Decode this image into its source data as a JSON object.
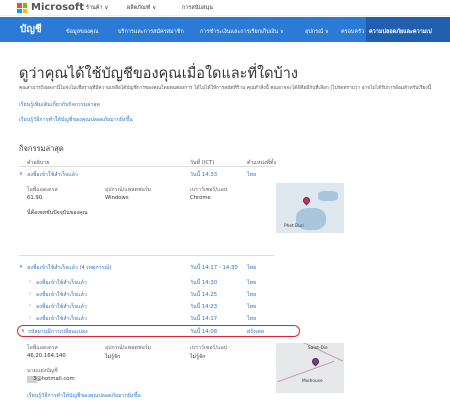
{
  "header": {
    "brand": "Microsoft",
    "nav": [
      "ร้านค้า ∨",
      "ผลิตภัณฑ์ ∨",
      "การสนับสนุน"
    ]
  },
  "account_nav": {
    "title": "บัญชี",
    "items": [
      "ข้อมูลของคุณ",
      "บริการและการสมัครสมาชิก",
      "การชำระเงินและการเรียกเก็บเงิน ∨",
      "อุปกรณ์ ∨",
      "ครอบครัว",
      "ความปลอดภัยและความเป"
    ]
  },
  "page": {
    "title": "ดูว่าคุณได้ใช้บัญชีของคุณเมื่อใดและที่ใดบ้าง",
    "description": "คุณสามารถิ่งผลงานี่ไมจ่งไม่เชื่ยรายุที่มีความเหลือได้บัญชีการของคุณโดยตนต่องการ ได้ไม่ได้ให้การสมัตที่ร้าน คุณทำสิ่งนี้ คุณอาจจะได้อ้ทียมีกับที่เลือก (ไปรดทราบว่า อาจไม่ได้รับการอ้อมสำหรับเรียงนี้",
    "links": [
      "เรียนรู้เพิ่มเติมเกี่ยวกับกิจกรรมล่าสุด",
      "เรียนรู้วิธีการทำให้บัญชีของคุณปลอดภัยมากยิ่งขึ้น"
    ]
  },
  "activity": {
    "title": "กิจกรรมล่าสุด",
    "columns": [
      "คำอธิบาย",
      "วันที่ (ICT)",
      "ตำแหน่งที่ตั้ง"
    ],
    "entry1": {
      "desc": "ลงชื่อเข้าใช้สำเร็จแล้ว",
      "date": "วันนี้ 14:33",
      "loc": "ไทย",
      "ip_label": "ไอพีแอดเดรส",
      "ip": "61.90.",
      "device_label": "อุปกรณ์/แพลตฟอร์ม",
      "device": "Windows",
      "browser_label": "เบราว์เซอร์/แอป",
      "browser": "Chrome",
      "note": "นี่คือเซสชันปัจจุบันของคุณ"
    },
    "group": {
      "desc": "ลงชื่อเข้าใช้สำเร็จแล้ว (4 เหตุการณ์)",
      "date": "วันนี้ 14:17 - 14:30",
      "loc": "ไทย"
    },
    "sub": [
      {
        "desc": "ลงชื่อเข้าใช้สำเร็จแล้ว",
        "date": "วันนี้ 14:30",
        "loc": "ไทย"
      },
      {
        "desc": "ลงชื่อเข้าใช้สำเร็จแล้ว",
        "date": "วันนี้ 14:25",
        "loc": "ไทย"
      },
      {
        "desc": "ลงชื่อเข้าใช้สำเร็จแล้ว",
        "date": "วันนี้ 14:23",
        "loc": "ไทย"
      },
      {
        "desc": "ลงชื่อเข้าใช้สำเร็จแล้ว",
        "date": "วันนี้ 14:17",
        "loc": "ไทย"
      }
    ],
    "highlight": {
      "desc": "รหัสผ่านมีการเปลี่ยนแปลง",
      "date": "วันนี้ 14:08",
      "loc": "ฝรั่งเศส",
      "ip_label": "ไอพีแอดเดรส",
      "ip": "46.20.164.140",
      "device_label": "อุปกรณ์/แพลตฟอร์ม",
      "device": "ไม่รู้จัก",
      "browser_label": "เบราว์เซอร์/แอป",
      "browser": "ไม่รู้จัก",
      "alias_label": "นามแฝงบัญชี",
      "alias": "3@hotmail.com",
      "bottom_link": "เรียนรู้วิธีการทำให้บัญชีของคุณปลอดภัยมากยิ่งขึ้น"
    },
    "map1_label": "Phet Buri",
    "map2_labels": [
      "Saint-Die",
      "Mulhouse"
    ]
  }
}
